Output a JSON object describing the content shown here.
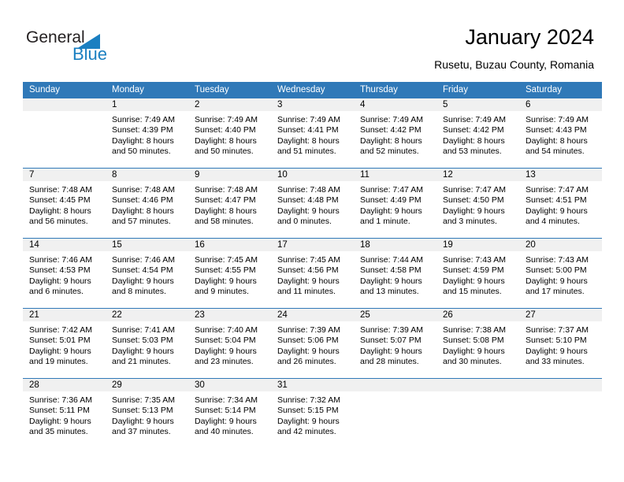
{
  "logo": {
    "word_one": "General",
    "word_two": "Blue",
    "triangle_color": "#1a7fc1",
    "text_color": "#231f20"
  },
  "header": {
    "title": "January 2024",
    "subtitle": "Rusetu, Buzau County, Romania"
  },
  "theme": {
    "header_bg": "#3079b8",
    "header_text": "#ffffff",
    "daynum_band": "#f0f0f0",
    "cell_bg": "#ffffff",
    "separator": "#3079b8"
  },
  "calendar": {
    "weekday_headers": [
      "Sunday",
      "Monday",
      "Tuesday",
      "Wednesday",
      "Thursday",
      "Friday",
      "Saturday"
    ],
    "weeks": [
      [
        {
          "day": "",
          "empty": true,
          "sunrise": "",
          "sunset": "",
          "daylight_line1": "",
          "daylight_line2": ""
        },
        {
          "day": "1",
          "empty": false,
          "sunrise": "Sunrise: 7:49 AM",
          "sunset": "Sunset: 4:39 PM",
          "daylight_line1": "Daylight: 8 hours",
          "daylight_line2": "and 50 minutes."
        },
        {
          "day": "2",
          "empty": false,
          "sunrise": "Sunrise: 7:49 AM",
          "sunset": "Sunset: 4:40 PM",
          "daylight_line1": "Daylight: 8 hours",
          "daylight_line2": "and 50 minutes."
        },
        {
          "day": "3",
          "empty": false,
          "sunrise": "Sunrise: 7:49 AM",
          "sunset": "Sunset: 4:41 PM",
          "daylight_line1": "Daylight: 8 hours",
          "daylight_line2": "and 51 minutes."
        },
        {
          "day": "4",
          "empty": false,
          "sunrise": "Sunrise: 7:49 AM",
          "sunset": "Sunset: 4:42 PM",
          "daylight_line1": "Daylight: 8 hours",
          "daylight_line2": "and 52 minutes."
        },
        {
          "day": "5",
          "empty": false,
          "sunrise": "Sunrise: 7:49 AM",
          "sunset": "Sunset: 4:42 PM",
          "daylight_line1": "Daylight: 8 hours",
          "daylight_line2": "and 53 minutes."
        },
        {
          "day": "6",
          "empty": false,
          "sunrise": "Sunrise: 7:49 AM",
          "sunset": "Sunset: 4:43 PM",
          "daylight_line1": "Daylight: 8 hours",
          "daylight_line2": "and 54 minutes."
        }
      ],
      [
        {
          "day": "7",
          "empty": false,
          "sunrise": "Sunrise: 7:48 AM",
          "sunset": "Sunset: 4:45 PM",
          "daylight_line1": "Daylight: 8 hours",
          "daylight_line2": "and 56 minutes."
        },
        {
          "day": "8",
          "empty": false,
          "sunrise": "Sunrise: 7:48 AM",
          "sunset": "Sunset: 4:46 PM",
          "daylight_line1": "Daylight: 8 hours",
          "daylight_line2": "and 57 minutes."
        },
        {
          "day": "9",
          "empty": false,
          "sunrise": "Sunrise: 7:48 AM",
          "sunset": "Sunset: 4:47 PM",
          "daylight_line1": "Daylight: 8 hours",
          "daylight_line2": "and 58 minutes."
        },
        {
          "day": "10",
          "empty": false,
          "sunrise": "Sunrise: 7:48 AM",
          "sunset": "Sunset: 4:48 PM",
          "daylight_line1": "Daylight: 9 hours",
          "daylight_line2": "and 0 minutes."
        },
        {
          "day": "11",
          "empty": false,
          "sunrise": "Sunrise: 7:47 AM",
          "sunset": "Sunset: 4:49 PM",
          "daylight_line1": "Daylight: 9 hours",
          "daylight_line2": "and 1 minute."
        },
        {
          "day": "12",
          "empty": false,
          "sunrise": "Sunrise: 7:47 AM",
          "sunset": "Sunset: 4:50 PM",
          "daylight_line1": "Daylight: 9 hours",
          "daylight_line2": "and 3 minutes."
        },
        {
          "day": "13",
          "empty": false,
          "sunrise": "Sunrise: 7:47 AM",
          "sunset": "Sunset: 4:51 PM",
          "daylight_line1": "Daylight: 9 hours",
          "daylight_line2": "and 4 minutes."
        }
      ],
      [
        {
          "day": "14",
          "empty": false,
          "sunrise": "Sunrise: 7:46 AM",
          "sunset": "Sunset: 4:53 PM",
          "daylight_line1": "Daylight: 9 hours",
          "daylight_line2": "and 6 minutes."
        },
        {
          "day": "15",
          "empty": false,
          "sunrise": "Sunrise: 7:46 AM",
          "sunset": "Sunset: 4:54 PM",
          "daylight_line1": "Daylight: 9 hours",
          "daylight_line2": "and 8 minutes."
        },
        {
          "day": "16",
          "empty": false,
          "sunrise": "Sunrise: 7:45 AM",
          "sunset": "Sunset: 4:55 PM",
          "daylight_line1": "Daylight: 9 hours",
          "daylight_line2": "and 9 minutes."
        },
        {
          "day": "17",
          "empty": false,
          "sunrise": "Sunrise: 7:45 AM",
          "sunset": "Sunset: 4:56 PM",
          "daylight_line1": "Daylight: 9 hours",
          "daylight_line2": "and 11 minutes."
        },
        {
          "day": "18",
          "empty": false,
          "sunrise": "Sunrise: 7:44 AM",
          "sunset": "Sunset: 4:58 PM",
          "daylight_line1": "Daylight: 9 hours",
          "daylight_line2": "and 13 minutes."
        },
        {
          "day": "19",
          "empty": false,
          "sunrise": "Sunrise: 7:43 AM",
          "sunset": "Sunset: 4:59 PM",
          "daylight_line1": "Daylight: 9 hours",
          "daylight_line2": "and 15 minutes."
        },
        {
          "day": "20",
          "empty": false,
          "sunrise": "Sunrise: 7:43 AM",
          "sunset": "Sunset: 5:00 PM",
          "daylight_line1": "Daylight: 9 hours",
          "daylight_line2": "and 17 minutes."
        }
      ],
      [
        {
          "day": "21",
          "empty": false,
          "sunrise": "Sunrise: 7:42 AM",
          "sunset": "Sunset: 5:01 PM",
          "daylight_line1": "Daylight: 9 hours",
          "daylight_line2": "and 19 minutes."
        },
        {
          "day": "22",
          "empty": false,
          "sunrise": "Sunrise: 7:41 AM",
          "sunset": "Sunset: 5:03 PM",
          "daylight_line1": "Daylight: 9 hours",
          "daylight_line2": "and 21 minutes."
        },
        {
          "day": "23",
          "empty": false,
          "sunrise": "Sunrise: 7:40 AM",
          "sunset": "Sunset: 5:04 PM",
          "daylight_line1": "Daylight: 9 hours",
          "daylight_line2": "and 23 minutes."
        },
        {
          "day": "24",
          "empty": false,
          "sunrise": "Sunrise: 7:39 AM",
          "sunset": "Sunset: 5:06 PM",
          "daylight_line1": "Daylight: 9 hours",
          "daylight_line2": "and 26 minutes."
        },
        {
          "day": "25",
          "empty": false,
          "sunrise": "Sunrise: 7:39 AM",
          "sunset": "Sunset: 5:07 PM",
          "daylight_line1": "Daylight: 9 hours",
          "daylight_line2": "and 28 minutes."
        },
        {
          "day": "26",
          "empty": false,
          "sunrise": "Sunrise: 7:38 AM",
          "sunset": "Sunset: 5:08 PM",
          "daylight_line1": "Daylight: 9 hours",
          "daylight_line2": "and 30 minutes."
        },
        {
          "day": "27",
          "empty": false,
          "sunrise": "Sunrise: 7:37 AM",
          "sunset": "Sunset: 5:10 PM",
          "daylight_line1": "Daylight: 9 hours",
          "daylight_line2": "and 33 minutes."
        }
      ],
      [
        {
          "day": "28",
          "empty": false,
          "sunrise": "Sunrise: 7:36 AM",
          "sunset": "Sunset: 5:11 PM",
          "daylight_line1": "Daylight: 9 hours",
          "daylight_line2": "and 35 minutes."
        },
        {
          "day": "29",
          "empty": false,
          "sunrise": "Sunrise: 7:35 AM",
          "sunset": "Sunset: 5:13 PM",
          "daylight_line1": "Daylight: 9 hours",
          "daylight_line2": "and 37 minutes."
        },
        {
          "day": "30",
          "empty": false,
          "sunrise": "Sunrise: 7:34 AM",
          "sunset": "Sunset: 5:14 PM",
          "daylight_line1": "Daylight: 9 hours",
          "daylight_line2": "and 40 minutes."
        },
        {
          "day": "31",
          "empty": false,
          "sunrise": "Sunrise: 7:32 AM",
          "sunset": "Sunset: 5:15 PM",
          "daylight_line1": "Daylight: 9 hours",
          "daylight_line2": "and 42 minutes."
        },
        {
          "day": "",
          "empty": true,
          "sunrise": "",
          "sunset": "",
          "daylight_line1": "",
          "daylight_line2": ""
        },
        {
          "day": "",
          "empty": true,
          "sunrise": "",
          "sunset": "",
          "daylight_line1": "",
          "daylight_line2": ""
        },
        {
          "day": "",
          "empty": true,
          "sunrise": "",
          "sunset": "",
          "daylight_line1": "",
          "daylight_line2": ""
        }
      ]
    ]
  }
}
